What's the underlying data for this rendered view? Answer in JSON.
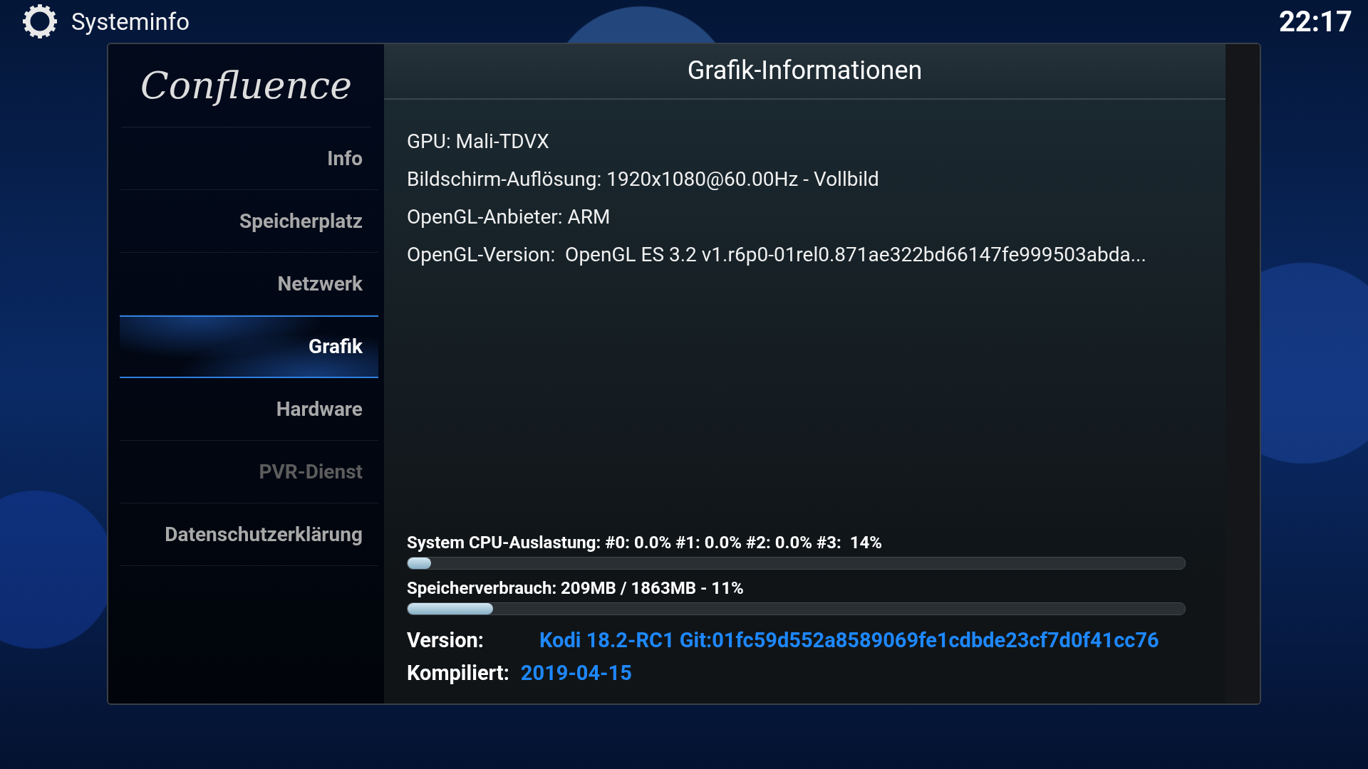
{
  "header": {
    "title": "Systeminfo",
    "clock": "22:17"
  },
  "sidebar": {
    "logo": "Confluence",
    "items": [
      {
        "label": "Info",
        "selected": false,
        "disabled": false
      },
      {
        "label": "Speicherplatz",
        "selected": false,
        "disabled": false
      },
      {
        "label": "Netzwerk",
        "selected": false,
        "disabled": false
      },
      {
        "label": "Grafik",
        "selected": true,
        "disabled": false
      },
      {
        "label": "Hardware",
        "selected": false,
        "disabled": false
      },
      {
        "label": "PVR-Dienst",
        "selected": false,
        "disabled": true
      },
      {
        "label": "Datenschutzerklärung",
        "selected": false,
        "disabled": false
      }
    ]
  },
  "content": {
    "title": "Grafik-Informationen",
    "lines": [
      "GPU: Mali-TDVX",
      "Bildschirm-Auflösung: 1920x1080@60.00Hz - Vollbild",
      "OpenGL-Anbieter: ARM",
      "OpenGL-Version:  OpenGL ES 3.2 v1.r6p0-01rel0.871ae322bd66147fe999503abda..."
    ],
    "meters": [
      {
        "label": "System CPU-Auslastung: #0: 0.0% #1: 0.0% #2: 0.0% #3:  14%",
        "level": 0.03
      },
      {
        "label": "Speicherverbrauch: 209MB / 1863MB - 11%",
        "level": 0.11
      }
    ],
    "version": {
      "label": "Version:",
      "value": "Kodi 18.2-RC1 Git:01fc59d552a8589069fe1cdbde23cf7d0f41cc76"
    },
    "compiled": {
      "label": "Kompiliert:",
      "value": "2019-04-15"
    }
  }
}
